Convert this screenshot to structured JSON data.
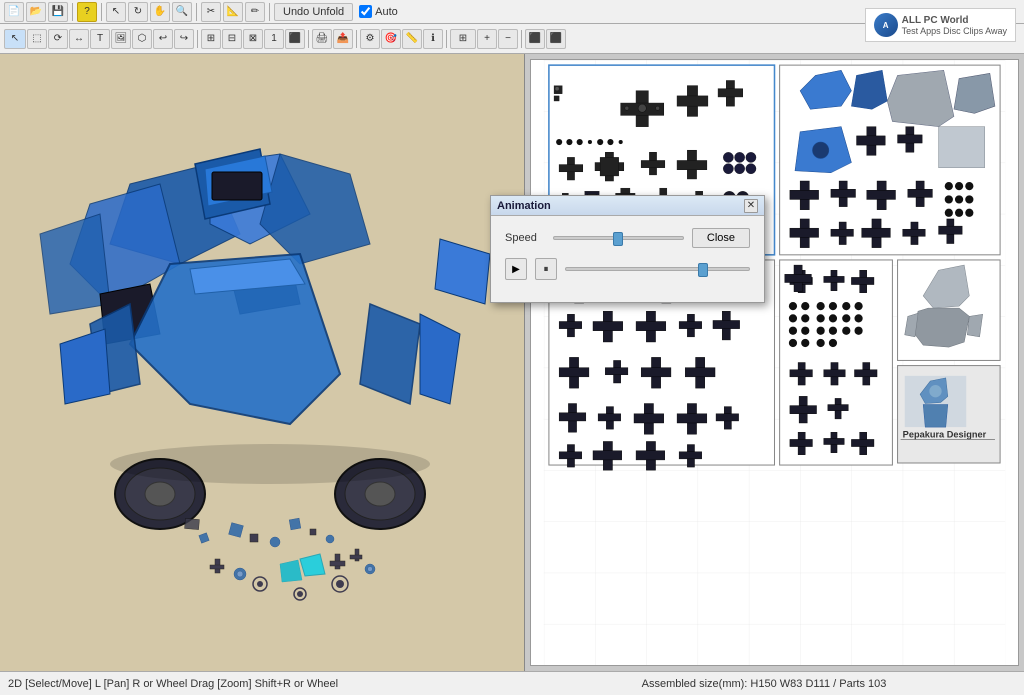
{
  "app": {
    "title": "Pepakura Designer",
    "watermark_line1": "Test Apps Disc Clips Away",
    "watermark_brand": "ALL PC World"
  },
  "toolbar_top": {
    "undo_unfold_label": "Undo Unfold",
    "auto_label": "Auto",
    "icons": [
      "new",
      "open",
      "save",
      "?",
      "select",
      "rotate",
      "pan",
      "zoom",
      "cut",
      "fold",
      "mark",
      "text",
      "image",
      "part",
      "undo",
      "redo",
      "flip",
      "mirror",
      "add",
      "select2",
      "zoom2",
      "rotate2",
      "align",
      "number",
      "export",
      "print",
      "settings",
      "3d",
      "info"
    ]
  },
  "animation_dialog": {
    "title": "Animation",
    "speed_label": "Speed",
    "close_button": "Close",
    "play_tooltip": "Play",
    "pause_tooltip": "Pause"
  },
  "status_bar": {
    "left_text": "2D [Select/Move] L [Pan] R or Wheel Drag [Zoom] Shift+R or Wheel",
    "right_text": "Assembled size(mm): H150 W83 D111 / Parts 103"
  },
  "pepakura_label": "Pepakura Designer"
}
